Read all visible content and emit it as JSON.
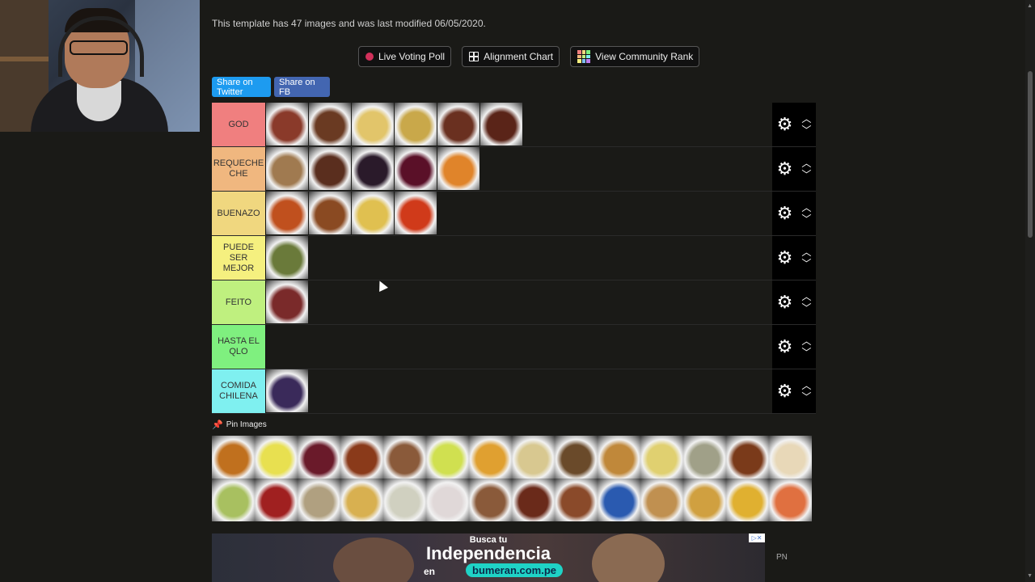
{
  "template_info": "This template has 47 images and was last modified 06/05/2020.",
  "actions": {
    "live_voting": "Live Voting Poll",
    "alignment_chart": "Alignment Chart",
    "community_rank": "View Community Rank"
  },
  "share": {
    "twitter": "Share on Twitter",
    "facebook": "Share on FB"
  },
  "tiers": [
    {
      "label": "GOD",
      "color": "#f07f7f",
      "items": [
        "#8a3a2a",
        "#6a3a22",
        "#e2c56a",
        "#c9a84a",
        "#6a3020",
        "#5a2418"
      ]
    },
    {
      "label": "REQUECHE CHE",
      "color": "#f0b77f",
      "items": [
        "#a07a50",
        "#5a2e1e",
        "#2a1a2a",
        "#5a1028",
        "#e0842a"
      ]
    },
    {
      "label": "BUENAZO",
      "color": "#f0d77f",
      "items": [
        "#c0501e",
        "#8a4a22",
        "#e0c050",
        "#d03a1a"
      ]
    },
    {
      "label": "PUEDE SER MEJOR",
      "color": "#f5f07f",
      "items": [
        "#6a7a3a"
      ]
    },
    {
      "label": "FEITO",
      "color": "#bff07f",
      "items": [
        "#7a2a2a"
      ]
    },
    {
      "label": "HASTA EL QLO",
      "color": "#7ff07f",
      "items": []
    },
    {
      "label": "COMIDA CHILENA",
      "color": "#7ff0f0",
      "items": [
        "#3a2a5a"
      ]
    }
  ],
  "pin_label": "Pin Images",
  "pool": [
    "#c0701e",
    "#e8e050",
    "#6a1a2a",
    "#8a3a1a",
    "#8a5a3a",
    "#d0e050",
    "#e0a030",
    "#d8c890",
    "#6a4a2a",
    "#c0883a",
    "#e0d070",
    "#a0a088",
    "#7a3a1a",
    "#e8d8b8",
    "#a8c060",
    "#a02020",
    "#b0a080",
    "#d8b050",
    "#d0d0c0",
    "#e0d8d8",
    "#8a5a3a",
    "#6a2a1a",
    "#8a4a2a",
    "#2a5ab0",
    "#c09050",
    "#d0a040",
    "#e0b030",
    "#e07040"
  ],
  "ad": {
    "top": "Busca tu",
    "headline": "Independencia",
    "prefix": "en",
    "url": "bumeran.com.pe"
  },
  "corner_text": "PN",
  "colors": {
    "background": "#1a1a17",
    "control_bg": "#000000",
    "twitter": "#1d9bf0",
    "facebook": "#4366b1",
    "live_dot": "#d0305a"
  }
}
